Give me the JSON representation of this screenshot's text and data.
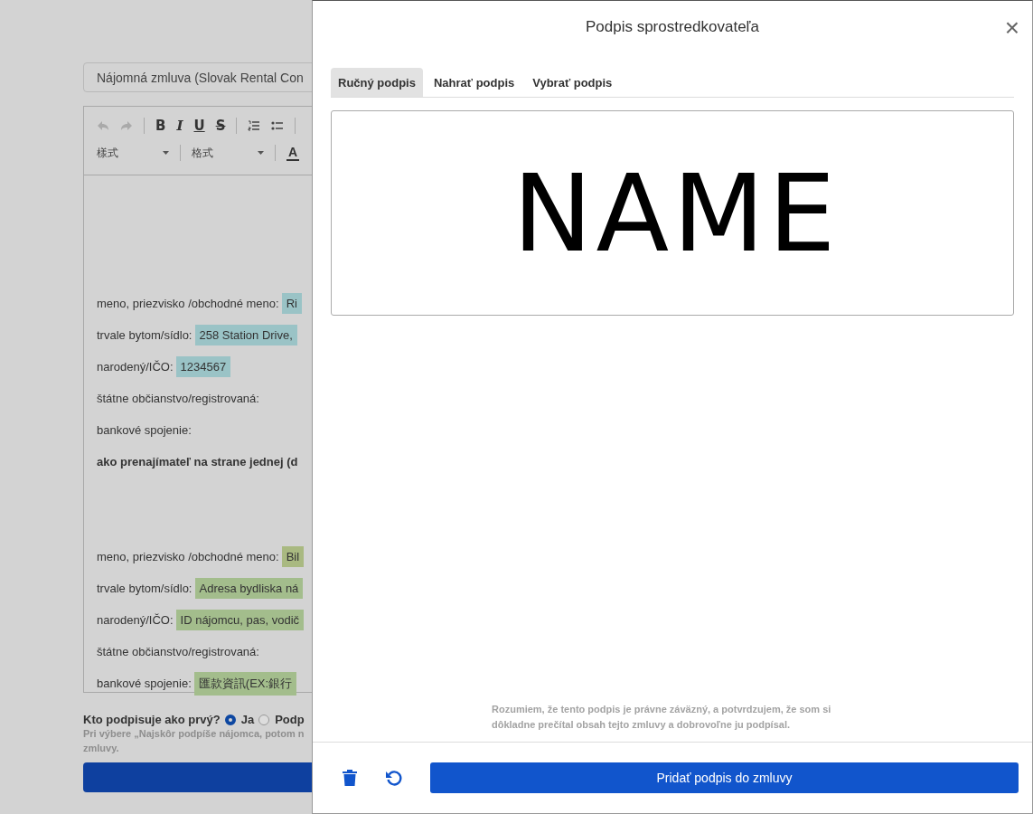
{
  "document": {
    "title_field": "Nájomná zmluva (Slovak Rental Con",
    "toolbar": [
      [
        {
          "kind": "undo",
          "disabled": true
        },
        {
          "kind": "redo",
          "disabled": true
        },
        {
          "kind": "sep"
        },
        {
          "kind": "bold",
          "text": "B"
        },
        {
          "kind": "italic",
          "text": "I"
        },
        {
          "kind": "underline",
          "text": "U"
        },
        {
          "kind": "strike",
          "text": "S"
        },
        {
          "kind": "sep"
        },
        {
          "kind": "ol"
        },
        {
          "kind": "ul"
        },
        {
          "kind": "sep"
        }
      ],
      [
        {
          "kind": "dropdown",
          "text": "樣式"
        },
        {
          "kind": "sep"
        },
        {
          "kind": "dropdown",
          "text": "格式"
        },
        {
          "kind": "sep"
        },
        {
          "kind": "color",
          "text": "A"
        }
      ]
    ],
    "sections": [
      {
        "fields": [
          {
            "label": "meno, priezvisko /obchodné meno:",
            "value": "Ri",
            "color": "#9ac3c6"
          },
          {
            "label": "trvale bytom/sídlo:",
            "value": "258 Station Drive,",
            "color": "#9ac3c6"
          },
          {
            "label": "narodený/IČO:",
            "value": "1234567",
            "color": "#9ac3c6"
          },
          {
            "label": "štátne občianstvo/registrovaná:"
          },
          {
            "label": "bankové spojenie:"
          }
        ],
        "closing": "ako prenajímateľ na strane jednej (d"
      },
      {
        "fields": [
          {
            "label": "meno, priezvisko /obchodné meno:",
            "value": "Bil",
            "color": "#a9b981"
          },
          {
            "label": "trvale bytom/sídlo:",
            "value": "Adresa bydliska ná",
            "color": "#a3bd8c"
          },
          {
            "label": "narodený/IČO:",
            "value": "ID nájomcu, pas, vodič",
            "color": "#a3bd8c"
          },
          {
            "label": "štátne občianstvo/registrovaná:"
          },
          {
            "label": "bankové spojenie:",
            "value": "匯款資訊(EX:銀行",
            "color": "#a3bd8c"
          }
        ]
      }
    ]
  },
  "first_signer": {
    "label": "Kto podpisuje ako prvý?",
    "options": [
      {
        "label": "Ja",
        "selected": true
      },
      {
        "label": "Podp",
        "selected": false
      }
    ],
    "hint": [
      "Pri výbere „Najskôr podpíše nájomca, potom n",
      "zmluvy."
    ]
  },
  "dialog": {
    "title": "Podpis sprostredkovateľa",
    "close": "×",
    "tabs": [
      {
        "label": "Ručný podpis",
        "selected": true
      },
      {
        "label": "Nahrať podpis",
        "selected": false
      },
      {
        "label": "Vybrať podpis",
        "selected": false
      }
    ],
    "signature": "NAME",
    "consent": "Rozumiem, že tento podpis je právne záväzný, a potvrdzujem, že som si dôkladne prečítal obsah tejto zmluvy a dobrovoľne ju podpísal.",
    "submit": "Pridať podpis do zmluvy"
  }
}
